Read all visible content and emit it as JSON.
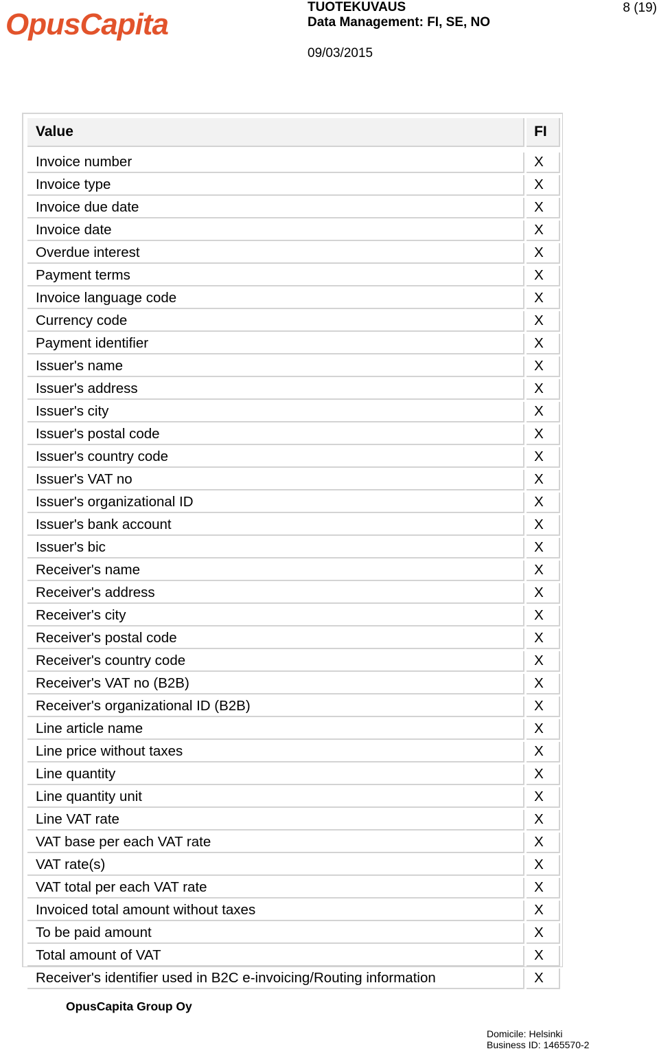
{
  "header": {
    "logo_text_1": "Opus",
    "logo_text_2": "Capita",
    "title": "TUOTEKUVAUS",
    "subtitle": "Data Management: FI, SE, NO",
    "date": "09/03/2015",
    "page": "8 (19)"
  },
  "table": {
    "columns": [
      "Value",
      "FI"
    ],
    "rows": [
      {
        "value": "Invoice number",
        "fi": "X"
      },
      {
        "value": "Invoice type",
        "fi": "X"
      },
      {
        "value": "Invoice due date",
        "fi": "X"
      },
      {
        "value": "Invoice date",
        "fi": "X"
      },
      {
        "value": "Overdue interest",
        "fi": "X"
      },
      {
        "value": "Payment terms",
        "fi": "X"
      },
      {
        "value": "Invoice language code",
        "fi": "X"
      },
      {
        "value": "Currency code",
        "fi": "X"
      },
      {
        "value": "Payment identifier",
        "fi": "X"
      },
      {
        "value": "Issuer's name",
        "fi": "X"
      },
      {
        "value": "Issuer's address",
        "fi": "X"
      },
      {
        "value": "Issuer's city",
        "fi": "X"
      },
      {
        "value": "Issuer's postal code",
        "fi": "X"
      },
      {
        "value": "Issuer's country code",
        "fi": "X"
      },
      {
        "value": "Issuer's VAT no",
        "fi": "X"
      },
      {
        "value": "Issuer's organizational ID",
        "fi": "X"
      },
      {
        "value": "Issuer's bank account",
        "fi": "X"
      },
      {
        "value": "Issuer's bic",
        "fi": "X"
      },
      {
        "value": "Receiver's name",
        "fi": "X"
      },
      {
        "value": "Receiver's address",
        "fi": "X"
      },
      {
        "value": "Receiver's city",
        "fi": "X"
      },
      {
        "value": "Receiver's postal code",
        "fi": "X"
      },
      {
        "value": "Receiver's country code",
        "fi": "X"
      },
      {
        "value": "Receiver's VAT no (B2B)",
        "fi": "X"
      },
      {
        "value": "Receiver's organizational ID (B2B)",
        "fi": "X"
      },
      {
        "value": "Line article name",
        "fi": "X"
      },
      {
        "value": "Line price without taxes",
        "fi": "X"
      },
      {
        "value": "Line quantity",
        "fi": "X"
      },
      {
        "value": "Line quantity unit",
        "fi": "X"
      },
      {
        "value": "Line VAT rate",
        "fi": "X"
      },
      {
        "value": "VAT base per each VAT rate",
        "fi": "X"
      },
      {
        "value": "VAT rate(s)",
        "fi": "X"
      },
      {
        "value": "VAT total per each VAT rate",
        "fi": "X"
      },
      {
        "value": "Invoiced total amount without taxes",
        "fi": "X"
      },
      {
        "value": "To be paid amount",
        "fi": "X"
      },
      {
        "value": "Total amount of VAT",
        "fi": "X"
      },
      {
        "value": "Receiver's identifier used in B2C e-invoicing/Routing information",
        "fi": "X"
      }
    ]
  },
  "footer": {
    "company": "OpusCapita Group Oy",
    "domicile": "Domicile: Helsinki",
    "business_id": "Business ID: 1465570-2"
  }
}
